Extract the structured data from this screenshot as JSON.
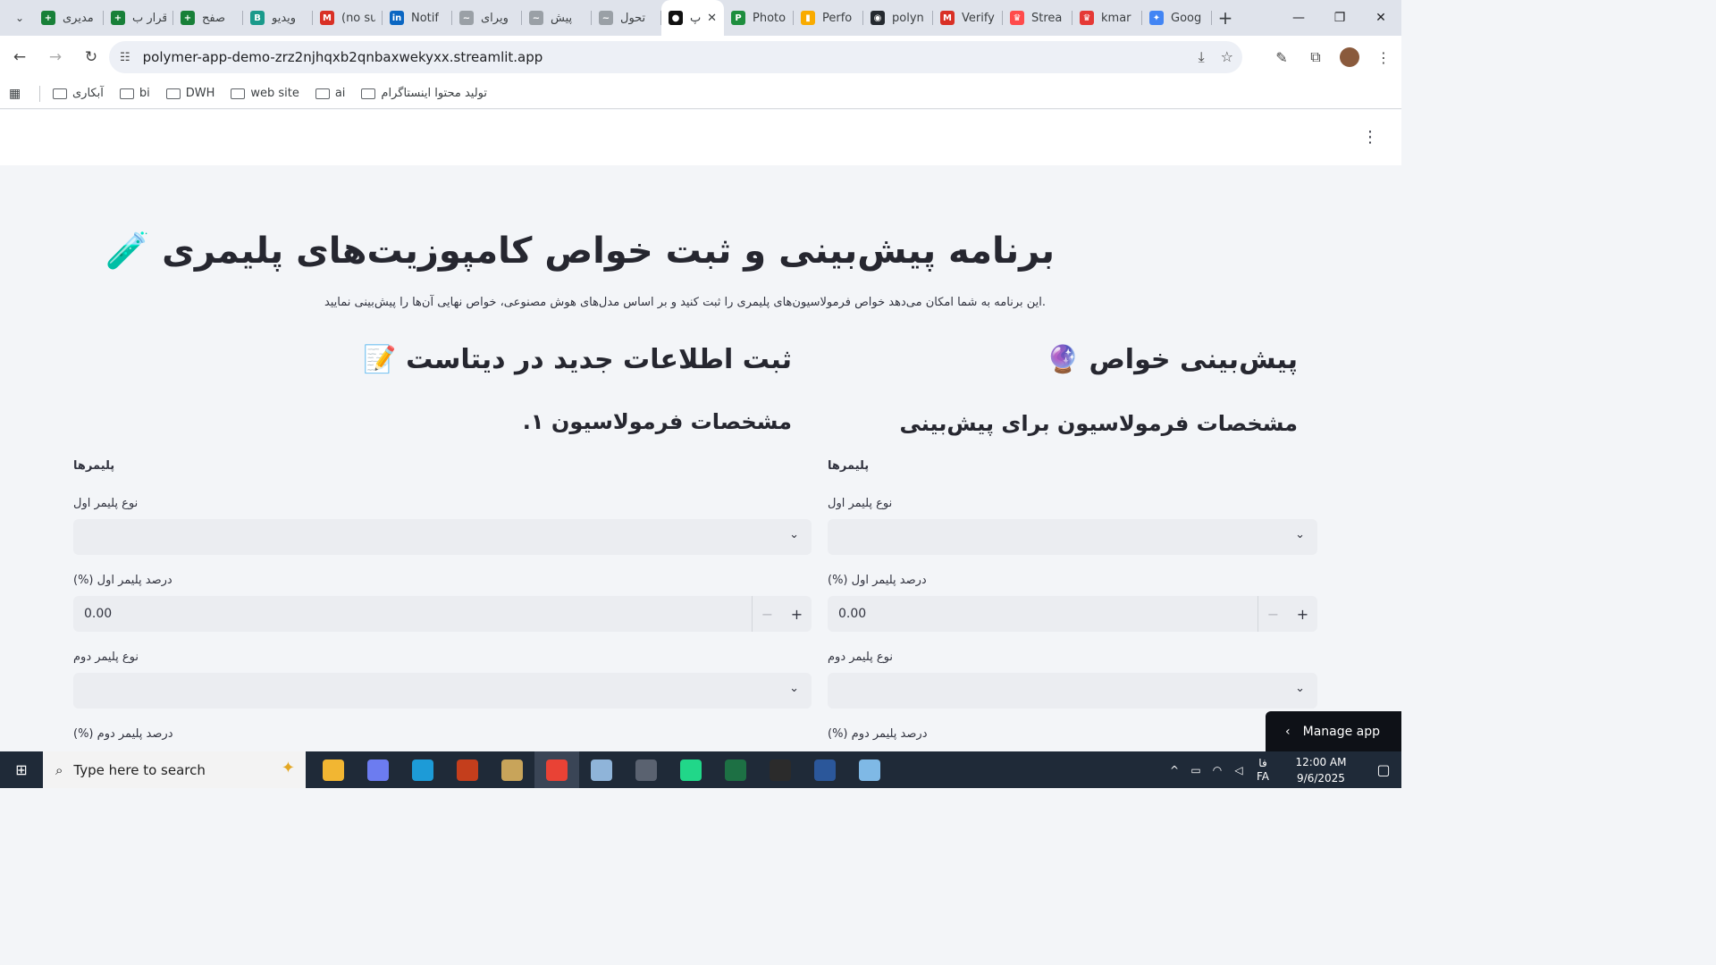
{
  "browser": {
    "tabs": [
      {
        "title": "مدیری",
        "color": "#188038",
        "glyph": "+"
      },
      {
        "title": "قرار ب",
        "color": "#188038",
        "glyph": "+"
      },
      {
        "title": "صفح",
        "color": "#188038",
        "glyph": "+"
      },
      {
        "title": "ویدیو",
        "color": "#1a9a8b",
        "glyph": "B"
      },
      {
        "title": "(no su",
        "color": "#d93025",
        "glyph": "M"
      },
      {
        "title": "Notif",
        "color": "#0a66c2",
        "glyph": "in"
      },
      {
        "title": "ویرای",
        "color": "#9aa0a6",
        "glyph": "~"
      },
      {
        "title": "پیش",
        "color": "#9aa0a6",
        "glyph": "~"
      },
      {
        "title": "تحول",
        "color": "#9aa0a6",
        "glyph": "~"
      },
      {
        "title": "پ",
        "color": "#111111",
        "glyph": "●",
        "active": true,
        "close": "✕"
      },
      {
        "title": "Photo",
        "color": "#1e8e3e",
        "glyph": "P"
      },
      {
        "title": "Perfo",
        "color": "#f9ab00",
        "glyph": "▮"
      },
      {
        "title": "polyn",
        "color": "#24292f",
        "glyph": "◉"
      },
      {
        "title": "Verify",
        "color": "#d93025",
        "glyph": "M"
      },
      {
        "title": "Strea",
        "color": "#ff4b4b",
        "glyph": "♛"
      },
      {
        "title": "kmar",
        "color": "#e53935",
        "glyph": "♛"
      },
      {
        "title": "Goog",
        "color": "#4285f4",
        "glyph": "✦"
      }
    ],
    "new_tab": "+",
    "url": "polymer-app-demo-zrz2njhqxb2qnbaxwekyxx.streamlit.app",
    "bookmarks": [
      "آبکاری",
      "bi",
      "DWH",
      "web site",
      "ai",
      "تولید محتوا اینستاگرام"
    ]
  },
  "app": {
    "title": "برنامه پیش‌بینی و ثبت خواص کامپوزیت‌های پلیمری 🧪",
    "subtitle": ".این برنامه به شما امکان می‌دهد خواص فرمولاسیون‌های پلیمری را ثبت کنید و بر اساس مدل‌های هوش مصنوعی، خواص نهایی آن‌ها را پیش‌بینی نمایید",
    "right_col": {
      "heading": "پیش‌بینی خواص 🔮",
      "subheading": "مشخصات فرمولاسیون برای پیش‌بینی",
      "group": "پلیمرها",
      "poly1_type": "نوع پلیمر اول",
      "poly1_pct": "(%) درصد پلیمر اول",
      "poly1_val": "0.00",
      "poly2_type": "نوع پلیمر دوم",
      "poly2_pct": "(%) درصد پلیمر دوم"
    },
    "left_col": {
      "heading": "ثبت اطلاعات جدید در دیتاست 📝",
      "subheading": "مشخصات فرمولاسیون ۱.",
      "group": "پلیمرها",
      "poly1_type": "نوع پلیمر اول",
      "poly1_pct": "(%) درصد پلیمر اول",
      "poly1_val": "0.00",
      "poly2_type": "نوع پلیمر دوم",
      "poly2_pct": "(%) درصد پلیمر دوم"
    },
    "manage_app": "Manage app"
  },
  "taskbar": {
    "search_placeholder": "Type here to search",
    "lang_top": "فا",
    "lang_bottom": "FA",
    "time": "12:00 AM",
    "date": "9/6/2025",
    "apps": [
      {
        "name": "file-explorer",
        "color": "#f2b632"
      },
      {
        "name": "copilot",
        "color": "#6c7cf0"
      },
      {
        "name": "edge",
        "color": "#1d9bd7"
      },
      {
        "name": "powerpoint",
        "color": "#c43e1c"
      },
      {
        "name": "app-feather",
        "color": "#c8a45a"
      },
      {
        "name": "chrome",
        "color": "#e94235",
        "active": true
      },
      {
        "name": "paint",
        "color": "#8fb4d9"
      },
      {
        "name": "security",
        "color": "#5a6270"
      },
      {
        "name": "pycharm",
        "color": "#21d789"
      },
      {
        "name": "excel",
        "color": "#1d7044"
      },
      {
        "name": "terminal",
        "color": "#2b2b2b"
      },
      {
        "name": "word",
        "color": "#2b579a"
      },
      {
        "name": "app-blue",
        "color": "#7fb9e6"
      }
    ]
  }
}
